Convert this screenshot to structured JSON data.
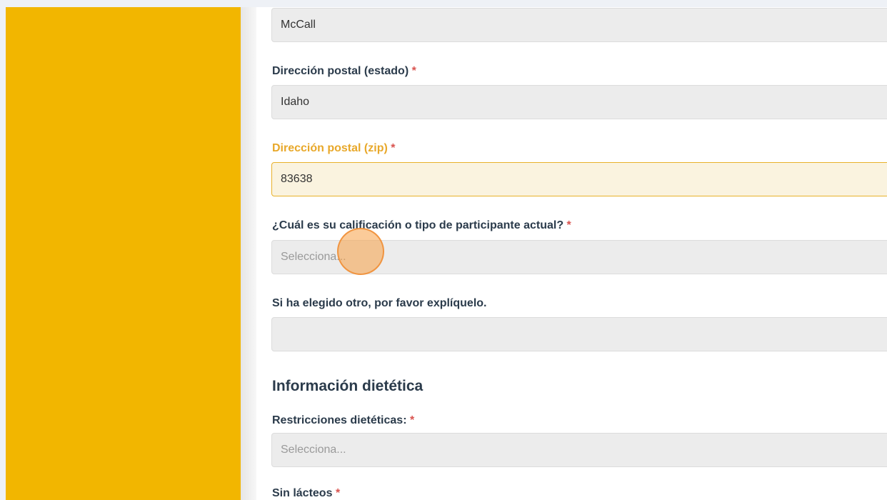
{
  "form": {
    "city_value": "McCall",
    "state_label": "Dirección postal (estado)",
    "state_value": "Idaho",
    "zip_label": "Dirección postal (zip)",
    "zip_value": "83638",
    "qualification_label": "¿Cuál es su calificación o tipo de participante actual?",
    "qualification_placeholder": "Selecciona...",
    "other_label": "Si ha elegido otro, por favor explíquelo.",
    "other_value": "",
    "dietary_section_title": "Información dietética",
    "dietary_restrictions_label": "Restricciones dietéticas:",
    "dietary_restrictions_placeholder": "Selecciona...",
    "dairy_free_label": "Sin lácteos",
    "required_mark": "*"
  },
  "colors": {
    "sidebar": "#f2b600",
    "focus_accent": "#e8a82a",
    "required": "#d9534f",
    "click_indicator": "#f7a046"
  }
}
